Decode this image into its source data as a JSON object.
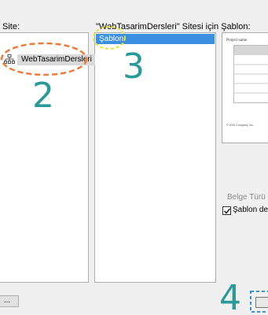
{
  "site_label": "Site:",
  "template_label": "\"WebTasarimDersleri\" Sitesi için Şablon:",
  "site_tree": {
    "node_label": "WebTasarimDersleri"
  },
  "templates": {
    "items": [
      "Şablon"
    ],
    "selected": 0
  },
  "preview": {
    "doc_title": "Project name",
    "doc_footer": "© 2015 Company, Inc."
  },
  "document_type_label": "Belge Türü",
  "change_template": {
    "label": "Şablon değişi",
    "checked": true
  },
  "browse_button_label": "...",
  "callouts": [
    "2",
    "3",
    "4"
  ],
  "colors": {
    "callout_orange": "#f07a3a",
    "callout_yellow": "#e6e62a",
    "callout_teal": "#2a9a99",
    "selection": "#3a8fe0"
  }
}
